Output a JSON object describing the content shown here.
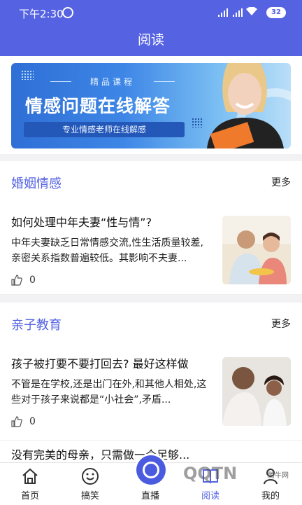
{
  "status_bar": {
    "time": "下午2:30",
    "battery": "32"
  },
  "header": {
    "title": "阅读"
  },
  "banner": {
    "kicker": "精品课程",
    "headline": "情感问题在线解答",
    "subline": "专业情感老师在线解感"
  },
  "sections": [
    {
      "title": "婚姻情感",
      "more": "更多",
      "article": {
        "title": "如何处理中年夫妻“性与情”?",
        "summary": "中年夫妻缺乏日常情感交流,性生活质量较差,亲密关系指数普遍较低。其影响不夫妻...",
        "likes": "0"
      }
    },
    {
      "title": "亲子教育",
      "more": "更多",
      "article": {
        "title": "孩子被打要不要打回去? 最好这样做",
        "summary": "不管是在学校,还是出门在外,和其他人相处,这些对于孩子来说都是“小社会”,矛盾...",
        "likes": "0"
      },
      "next_title": "没有完美的母亲，只需做一个足够..."
    }
  ],
  "tabbar": {
    "tabs": [
      "首页",
      "搞笑",
      "直播",
      "阅读",
      "我的"
    ]
  },
  "watermark": {
    "brand": "QQTN",
    "small": "腾牛网"
  },
  "colors": {
    "primary": "#5563e3"
  }
}
